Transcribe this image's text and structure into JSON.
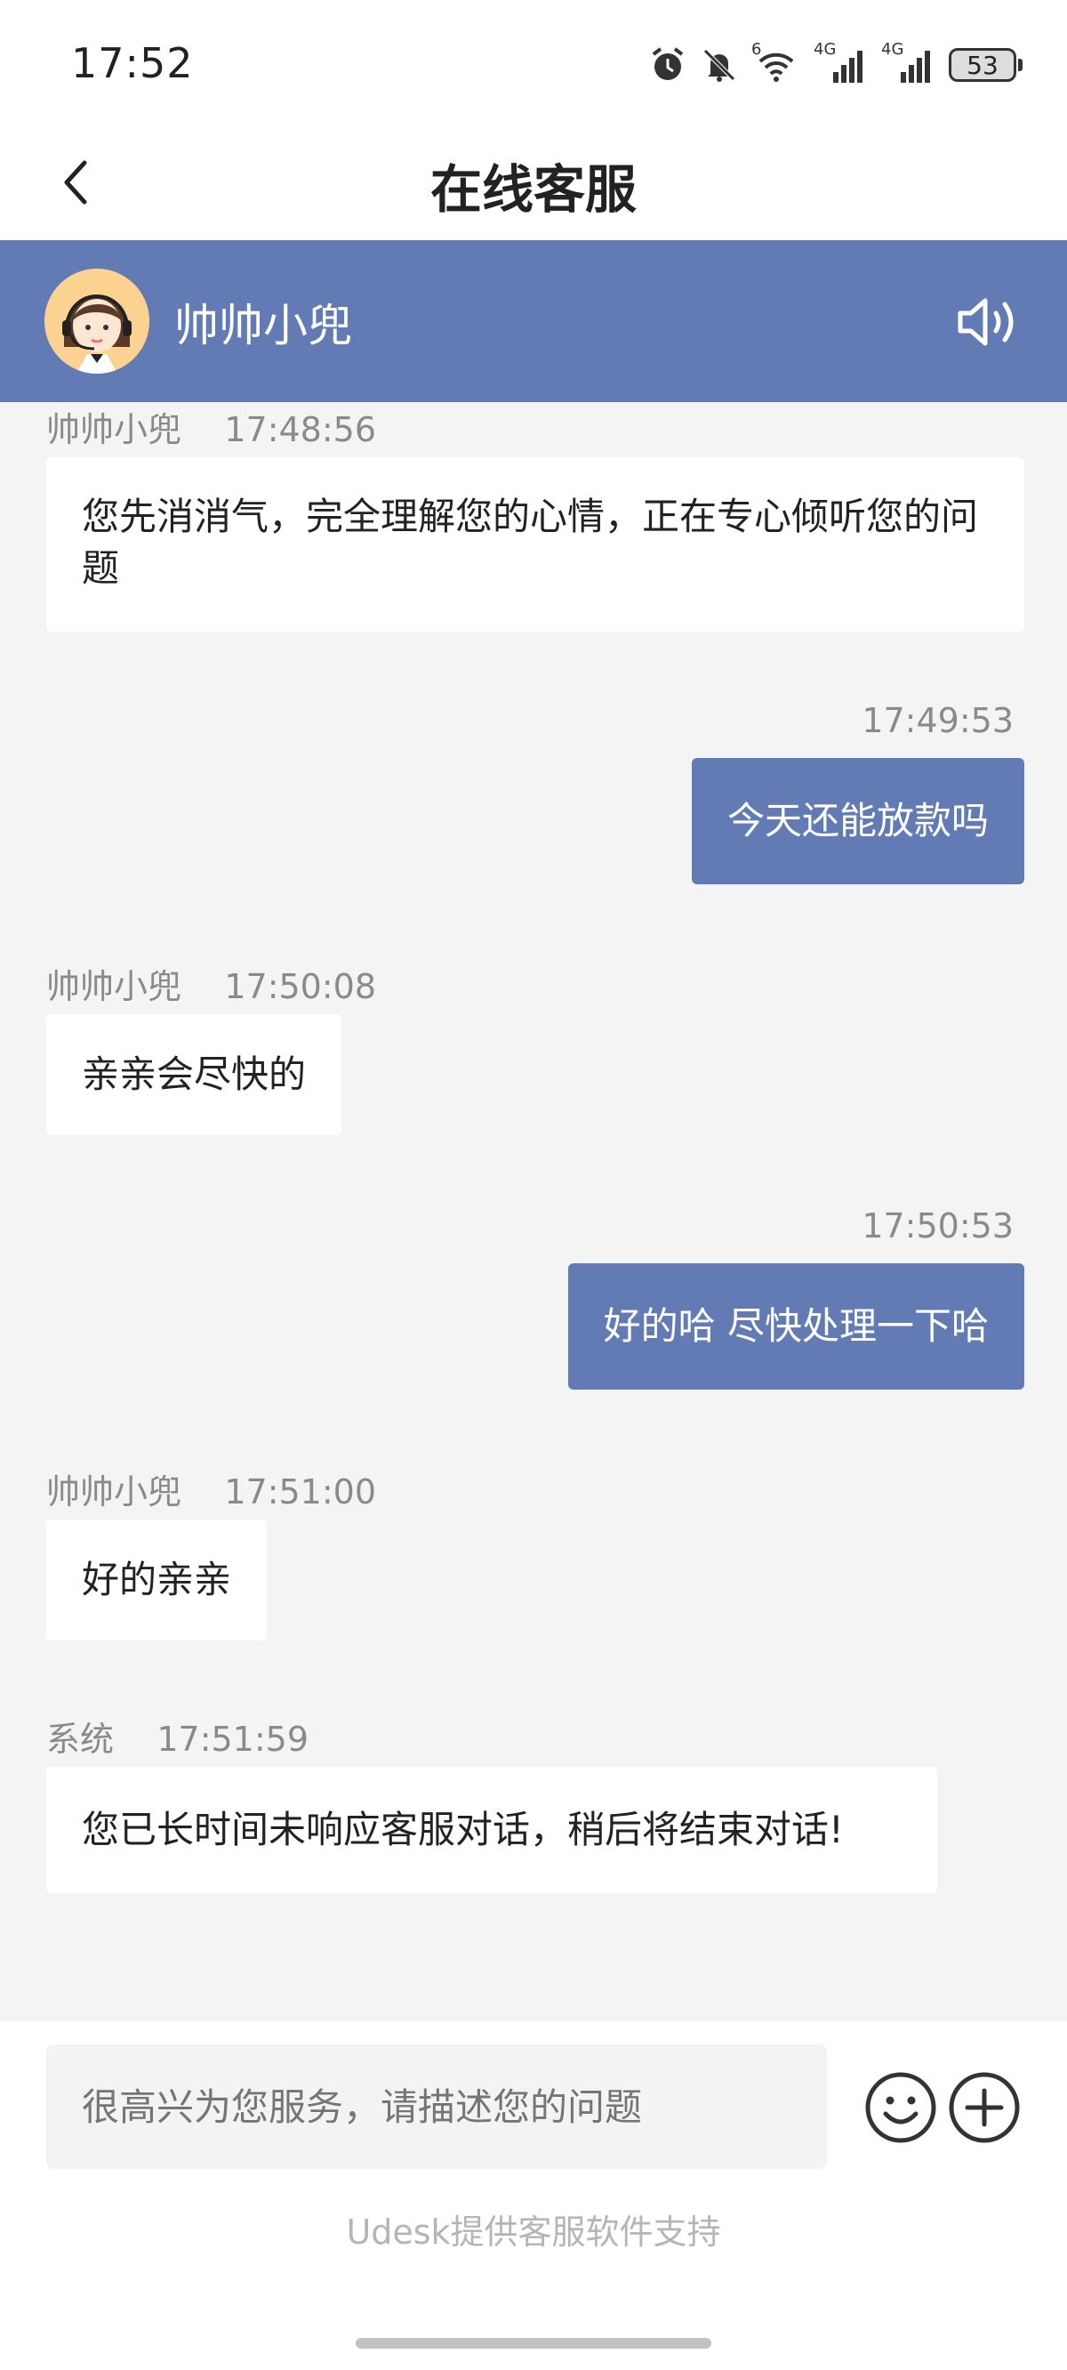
{
  "status_bar": {
    "time": "17:52",
    "network_label_1": "4G",
    "network_label_2": "4G",
    "wifi_label": "6",
    "battery": "53"
  },
  "nav": {
    "title": "在线客服"
  },
  "agent": {
    "name": "帅帅小兜"
  },
  "messages": [
    {
      "sender": "帅帅小兜",
      "time": "17:48:56",
      "direction": "in",
      "text_line1": "您先消消气，完全理解您的心情，正在专心倾听您的问",
      "text_line2": "题"
    },
    {
      "time": "17:49:53",
      "direction": "out",
      "text": "今天还能放款吗"
    },
    {
      "sender": "帅帅小兜",
      "time": "17:50:08",
      "direction": "in",
      "text": "亲亲会尽快的"
    },
    {
      "time": "17:50:53",
      "direction": "out",
      "text": "好的哈 尽快处理一下哈"
    },
    {
      "sender": "帅帅小兜",
      "time": "17:51:00",
      "direction": "in",
      "text": "好的亲亲"
    },
    {
      "sender": "系统",
      "time": "17:51:59",
      "direction": "in",
      "text": "您已长时间未响应客服对话，稍后将结束对话!"
    }
  ],
  "input": {
    "placeholder": "很高兴为您服务，请描述您的问题"
  },
  "footer": {
    "powered_by": "Udesk提供客服软件支持"
  },
  "colors": {
    "accent": "#637bb4",
    "background": "#f4f4f4"
  },
  "icons": [
    "back-arrow-icon",
    "speaker-icon",
    "emoji-icon",
    "plus-icon",
    "alarm-icon",
    "mute-bell-icon",
    "wifi-icon",
    "signal-icon",
    "battery-icon"
  ]
}
